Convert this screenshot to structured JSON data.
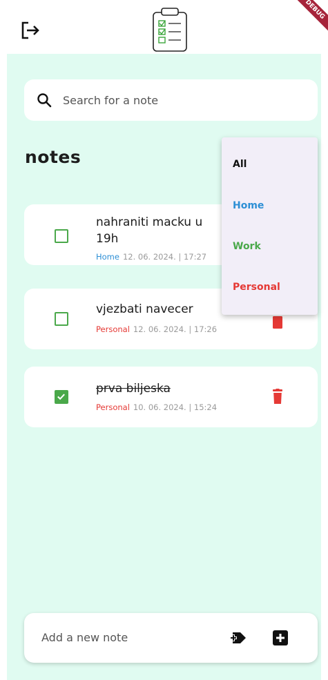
{
  "search": {
    "placeholder": "Search for a note"
  },
  "heading": "notes",
  "debug_label": "DEBUG",
  "notes": [
    {
      "title_line1": "nahraniti macku u",
      "title_line2": "19h",
      "category": "Home",
      "category_color": "#2d8fd5",
      "date": "12. 06. 2024. | 17:27",
      "checked": false
    },
    {
      "title_line1": "vjezbati navecer",
      "category": "Personal",
      "category_color": "#e53935",
      "date": "12. 06. 2024. | 17:26",
      "checked": false
    },
    {
      "title_line1": "prva biljeska",
      "category": "Personal",
      "category_color": "#e53935",
      "date": "10. 06. 2024. | 15:24",
      "checked": true
    }
  ],
  "menu": [
    {
      "label": "All",
      "color": "#111111"
    },
    {
      "label": "Home",
      "color": "#2d8fd5"
    },
    {
      "label": "Work",
      "color": "#4aa84a"
    },
    {
      "label": "Personal",
      "color": "#e53935"
    }
  ],
  "add_note": {
    "placeholder": "Add a new note"
  },
  "colors": {
    "background": "#e0fbf1",
    "checkbox": "#4aa84a",
    "trash": "#e53935"
  }
}
